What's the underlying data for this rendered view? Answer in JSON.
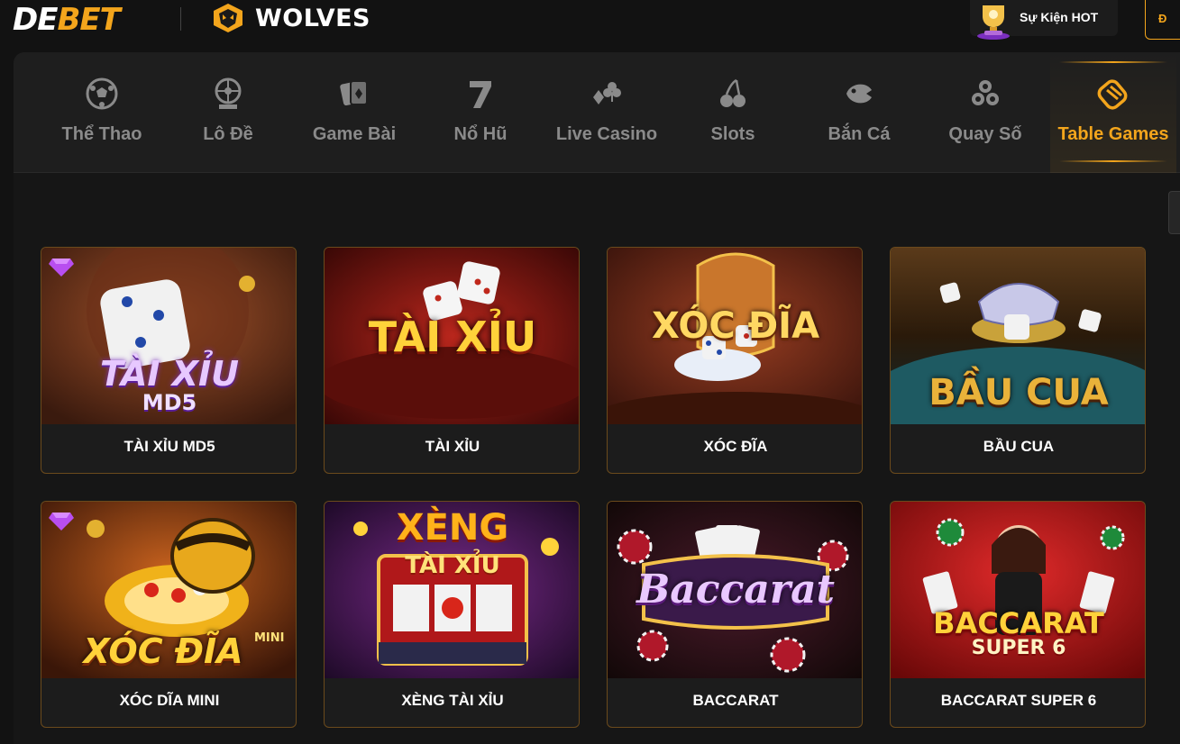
{
  "header": {
    "logo_de": "DE",
    "logo_bet": "BET",
    "partner": "WOLVES",
    "event_label": "Sự Kiện HOT",
    "login_label": "Đ"
  },
  "nav": {
    "items": [
      {
        "label": "Thể Thao",
        "icon": "soccer-ball-icon"
      },
      {
        "label": "Lô Đề",
        "icon": "lottery-wheel-icon"
      },
      {
        "label": "Game Bài",
        "icon": "playing-cards-icon"
      },
      {
        "label": "Nổ Hũ",
        "icon": "seven-icon"
      },
      {
        "label": "Live Casino",
        "icon": "clubs-diamonds-icon"
      },
      {
        "label": "Slots",
        "icon": "cherries-icon"
      },
      {
        "label": "Bắn Cá",
        "icon": "fish-icon"
      },
      {
        "label": "Quay Số",
        "icon": "lottery-balls-icon"
      },
      {
        "label": "Table Games",
        "icon": "table-games-icon",
        "active": true
      }
    ]
  },
  "games": [
    {
      "title": "TÀI XỈU MD5",
      "art_text": "TÀI XỈU",
      "art_sub": "MD5",
      "gem": true
    },
    {
      "title": "TÀI XỈU",
      "art_text": "TÀI XỈU",
      "art_sub": "",
      "gem": false
    },
    {
      "title": "XÓC ĐĨA",
      "art_text": "XÓC ĐĨA",
      "art_sub": "",
      "gem": false
    },
    {
      "title": "BẦU CUA",
      "art_text": "BẦU CUA",
      "art_sub": "",
      "gem": false
    },
    {
      "title": "XÓC DĨA MINI",
      "art_text": "XÓC ĐĨA",
      "art_sub": "MINI",
      "gem": true
    },
    {
      "title": "XÈNG TÀI XỈU",
      "art_text": "XÈNG",
      "art_sub": "TÀI XỈU",
      "gem": false
    },
    {
      "title": "BACCARAT",
      "art_text": "Baccarat",
      "art_sub": "",
      "gem": false
    },
    {
      "title": "BACCARAT SUPER 6",
      "art_text": "BACCARAT",
      "art_sub": "SUPER 6",
      "gem": false
    }
  ],
  "colors": {
    "accent": "#f3a51c",
    "card_border": "#6b4a1c",
    "nav_inactive": "#8a8a8a"
  }
}
